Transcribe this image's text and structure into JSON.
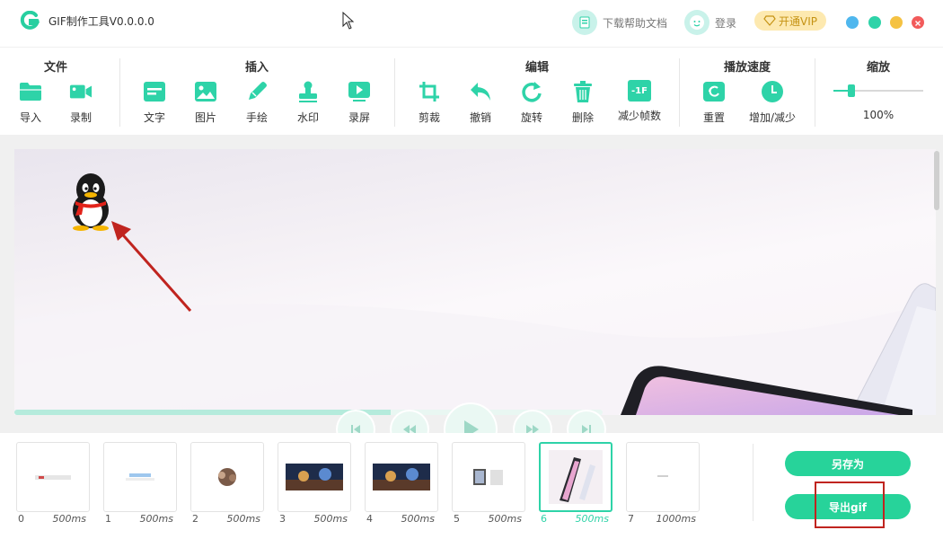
{
  "titlebar": {
    "app_title": "GIF制作工具V0.0.0.0",
    "help_docs_label": "下载帮助文档",
    "login_label": "登录",
    "vip_label": "开通VIP"
  },
  "toolbar": {
    "groups": {
      "file": "文件",
      "insert": "插入",
      "edit": "编辑",
      "speed": "播放速度",
      "zoom": "缩放"
    },
    "tools": {
      "import": "导入",
      "record": "录制",
      "text": "文字",
      "image": "图片",
      "draw": "手绘",
      "watermark": "水印",
      "screen_record": "录屏",
      "crop": "剪裁",
      "undo": "撤销",
      "rotate": "旋转",
      "delete": "删除",
      "reduce_frames": "减少帧数",
      "reset": "重置",
      "adjust": "增加/减少"
    },
    "reduce_frames_icon_text": "-1F",
    "zoom_value": "100%",
    "zoom_level": 0.2
  },
  "colors": {
    "accent": "#2ed3a8",
    "button": "#27d39a",
    "highlight_box": "#c0241f",
    "arrow": "#c0241f"
  },
  "playback": {
    "progress": 0.64
  },
  "frames": [
    {
      "index": "0",
      "duration": "500ms"
    },
    {
      "index": "1",
      "duration": "500ms"
    },
    {
      "index": "2",
      "duration": "500ms"
    },
    {
      "index": "3",
      "duration": "500ms"
    },
    {
      "index": "4",
      "duration": "500ms"
    },
    {
      "index": "5",
      "duration": "500ms"
    },
    {
      "index": "6",
      "duration": "500ms"
    },
    {
      "index": "7",
      "duration": "1000ms"
    }
  ],
  "selected_frame": "6",
  "actions": {
    "save_as": "另存为",
    "export_gif": "导出gif"
  }
}
